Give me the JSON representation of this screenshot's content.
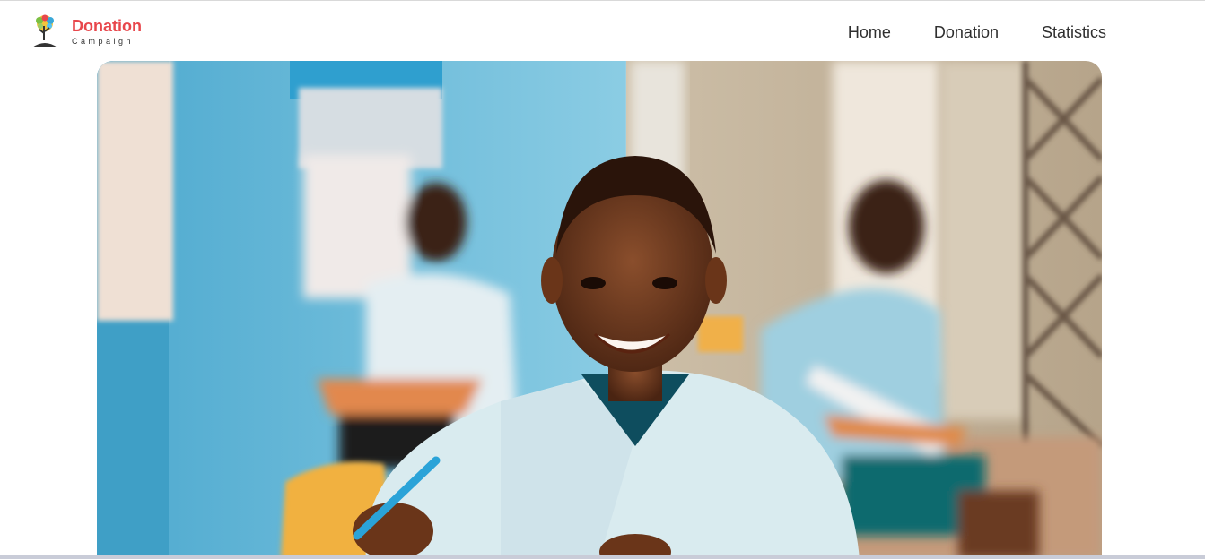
{
  "brand": {
    "name": "Donation",
    "tagline": "Campaign",
    "accent_color": "#e8474c",
    "icon": "tree-icon"
  },
  "nav": {
    "items": [
      {
        "label": "Home"
      },
      {
        "label": "Donation"
      },
      {
        "label": "Statistics"
      }
    ]
  },
  "hero": {
    "image_subject": "smiling-schoolboy-photo"
  }
}
